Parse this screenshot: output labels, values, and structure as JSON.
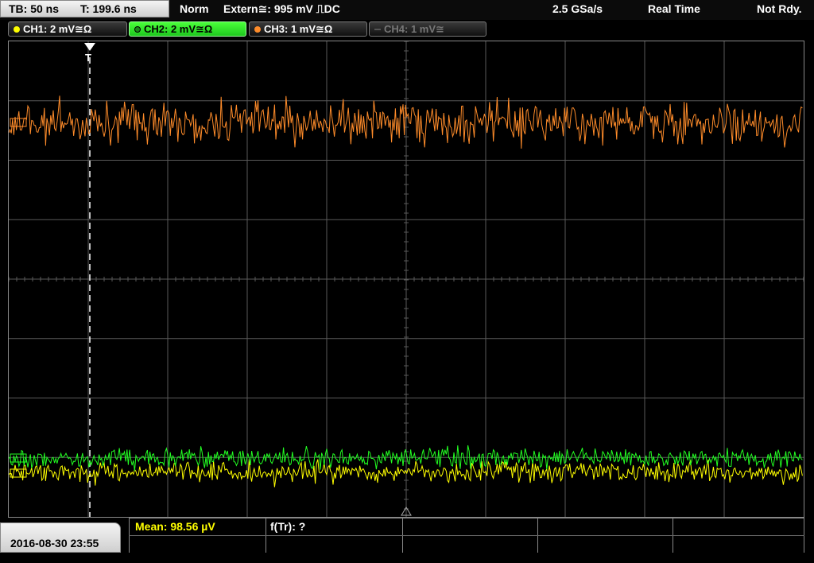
{
  "header": {
    "timebase": "TB: 50 ns",
    "trigger_time": "T: 199.6 ns",
    "trigger_mode": "Norm",
    "trigger_source": "Extern≅: 995 mV ⎍DC",
    "sample_rate": "2.5 GSa/s",
    "acq_mode": "Real Time",
    "status": "Not Rdy."
  },
  "channels": [
    {
      "label": "CH1: 2 mV≅Ω",
      "color": "#ffff00",
      "state": "on"
    },
    {
      "label": "CH2: 2 mV≅Ω",
      "color": "#22ff22",
      "state": "selected"
    },
    {
      "label": "CH3: 1 mV≅Ω",
      "color": "#ff8c2a",
      "state": "on"
    },
    {
      "label": "CH4: 1 mV≅",
      "color": "#777777",
      "state": "off"
    }
  ],
  "trigger_marker": "T",
  "footer": {
    "datetime": "2016-08-30 23:55",
    "measurement_mean": "Mean: 98.56 µV",
    "measurement_freq": "f(Tr): ?"
  },
  "colors": {
    "ch1": "#ffff00",
    "ch2": "#22ff22",
    "ch3": "#ff8c2a",
    "grid": "#5a5a5a",
    "trigger_line": "#ffffff"
  }
}
